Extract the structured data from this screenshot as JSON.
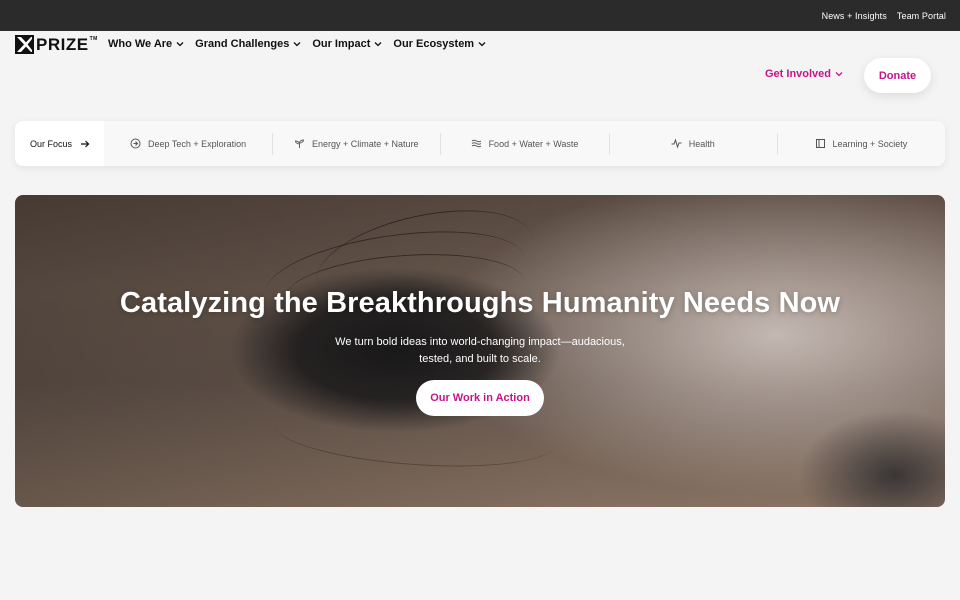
{
  "topbar": {
    "links": [
      "News + Insights",
      "Team Portal"
    ]
  },
  "logo": {
    "text": "PRIZE",
    "tm": "TM"
  },
  "nav": {
    "items": [
      {
        "label": "Who We Are",
        "icon": "chevron-down-icon"
      },
      {
        "label": "Grand Challenges",
        "icon": "chevron-down-icon"
      },
      {
        "label": "Our Impact",
        "icon": "chevron-down-icon"
      },
      {
        "label": "Our Ecosystem",
        "icon": "chevron-down-icon"
      }
    ],
    "get_involved": "Get Involved",
    "donate": "Donate"
  },
  "focus": {
    "head": "Our Focus",
    "items": [
      {
        "label": "Deep Tech + Exploration",
        "icon": "compass-icon"
      },
      {
        "label": "Energy + Climate + Nature",
        "icon": "sprout-icon"
      },
      {
        "label": "Food + Water + Waste",
        "icon": "waves-icon"
      },
      {
        "label": "Health",
        "icon": "pulse-icon"
      },
      {
        "label": "Learning + Society",
        "icon": "book-icon"
      }
    ]
  },
  "hero": {
    "title": "Catalyzing the Breakthroughs Humanity Needs Now",
    "subtitle_line1": "We turn bold ideas into world-changing impact—audacious,",
    "subtitle_line2": "tested, and built to scale.",
    "cta": "Our Work in Action"
  },
  "colors": {
    "accent": "#c4168a",
    "topbar": "#2b2b2b",
    "page_bg": "#f4f4f4"
  }
}
